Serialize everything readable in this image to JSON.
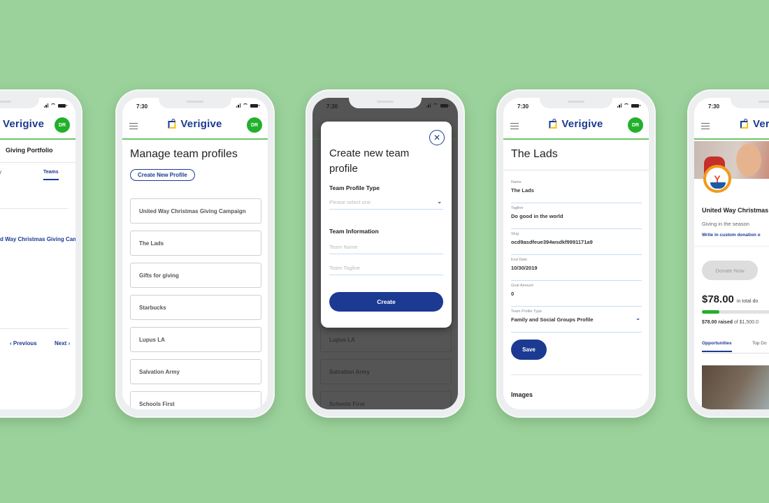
{
  "brand": {
    "name": "Verigive",
    "avatar_initials": "DR",
    "accent": "#1c3a92",
    "green": "#22b02b",
    "background": "#9bd19a"
  },
  "status_bar": {
    "time": "7:30"
  },
  "phone1": {
    "title": "Giving Portfolio",
    "tabs": [
      {
        "label": "Activity"
      },
      {
        "label": "Teams"
      }
    ],
    "link": "United Way Christmas Giving Campaign",
    "previous": "Previous",
    "next": "Next"
  },
  "phone2": {
    "title": "Manage team profiles",
    "create_button": "Create New Profile",
    "profiles": [
      "United Way Christmas Giving Campaign",
      "The Lads",
      "Gifts for giving",
      "Starbucks",
      "Lupus LA",
      "Salvation Army",
      "Schools First"
    ]
  },
  "phone3": {
    "modal_title": "Create new team profile",
    "profile_type_label": "Team Profile Type",
    "profile_type_placeholder": "Please select one",
    "team_info_label": "Team Information",
    "team_name_placeholder": "Team Name",
    "team_tagline_placeholder": "Team Tagline",
    "create_button": "Create",
    "background_items": [
      "Lupus LA",
      "Salvation Army",
      "Schools First"
    ]
  },
  "phone4": {
    "title": "The Lads",
    "fields": [
      {
        "label": "Name",
        "value": "The Lads"
      },
      {
        "label": "Tagline",
        "value": "Do good in the world"
      },
      {
        "label": "Slug",
        "value": "ocd9asdfeue394wsdkf9991171a9"
      },
      {
        "label": "End Date",
        "value": "10/30/2019"
      },
      {
        "label": "Goal Amount",
        "value": "0"
      },
      {
        "label": "Team Profile Type",
        "value": "Family and Social Groups Profile"
      }
    ],
    "save_button": "Save",
    "images_heading": "Images"
  },
  "phone5": {
    "campaign_name": "United Way Christmas",
    "tagline": "Giving in the season",
    "custom_link": "Write in custom donation o",
    "donate_button": "Donate Now",
    "amount": "$78.00",
    "amount_suffix": "in total do",
    "raised_amount": "$78.00",
    "raised_text": "raised",
    "goal_text": "of $1,500.0",
    "progress_fraction": 0.052,
    "tabs": [
      {
        "label": "Opportunities"
      },
      {
        "label": "Top Do"
      }
    ]
  }
}
